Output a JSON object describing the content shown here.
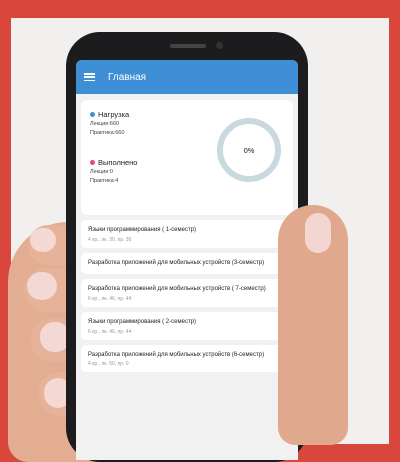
{
  "app": {
    "title": "Главная"
  },
  "summary": {
    "load": {
      "title": "Нагрузка",
      "lectures": "Лекции:660",
      "practice": "Практика:660",
      "color": "#3e8fd6"
    },
    "done": {
      "title": "Выполнено",
      "lectures": "Лекции:0",
      "practice": "Практика:4",
      "color": "#e7477a"
    },
    "progress_label": "0%",
    "progress_value": 0
  },
  "courses": [
    {
      "title": "Языки программирования ( 1-семестр)",
      "sub": "4 кр., лк. 30, пр. 30"
    },
    {
      "title": "Разработка приложений для мобильных устройств (3-семестр)",
      "sub": ""
    },
    {
      "title": "Разработка приложений для мобильных устройств ( 7-семестр)",
      "sub": "6 кр., лк. 46, пр. 44"
    },
    {
      "title": "Языки программирования ( 2-семестр)",
      "sub": "6 кр., лк. 46, пр. 44"
    },
    {
      "title": "Разработка приложений для мобильных устройств (6-семестр)",
      "sub": "4 кр., лк. 60, пр. 0"
    }
  ],
  "colors": {
    "background": "#d9463b",
    "appbar": "#3e8fd6"
  },
  "icons": {
    "menu": "hamburger-menu-icon"
  }
}
